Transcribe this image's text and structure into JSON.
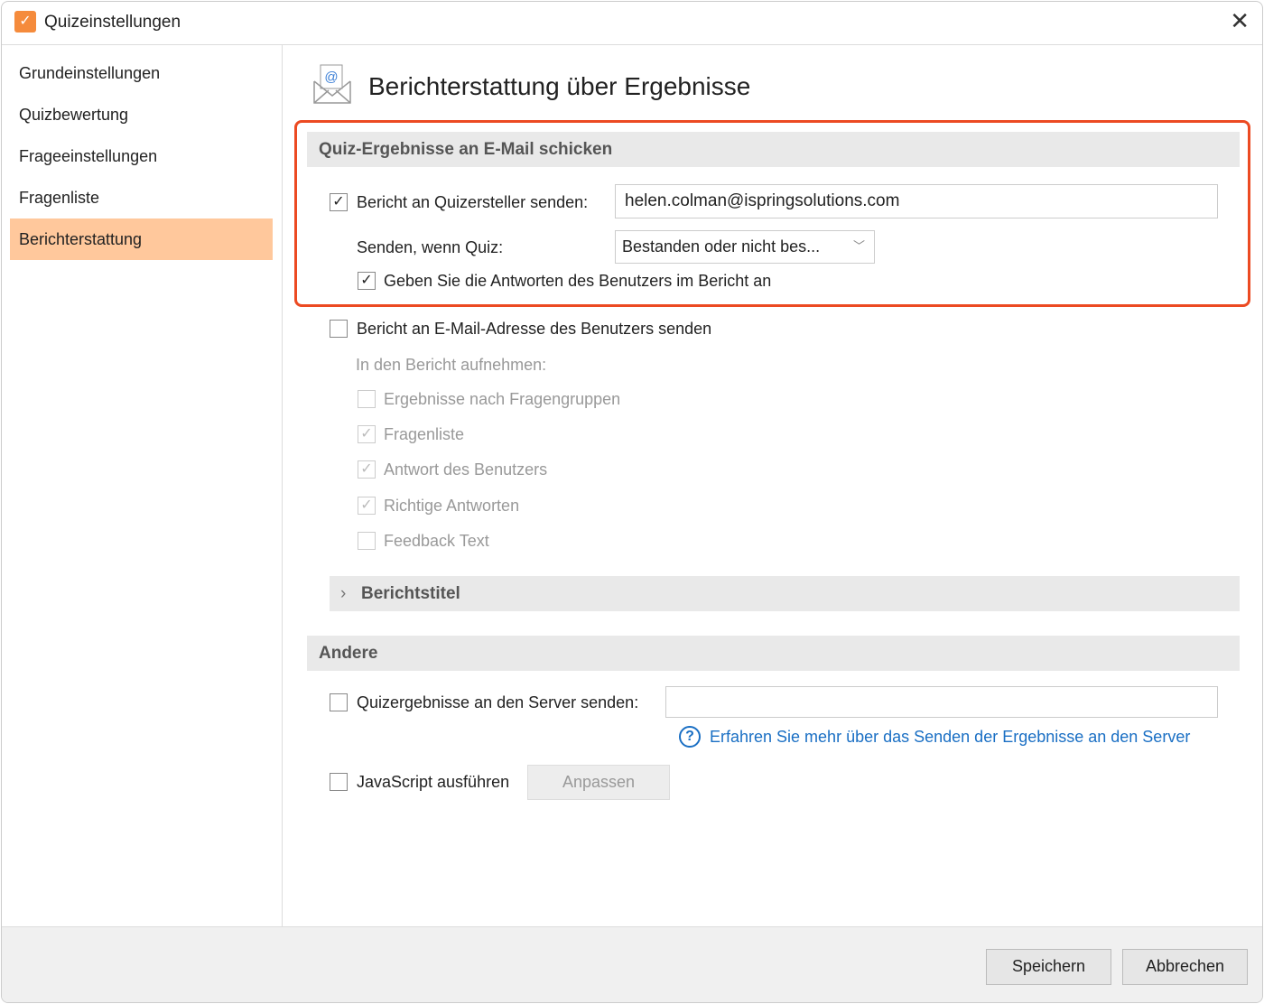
{
  "window": {
    "title": "Quizeinstellungen",
    "app_icon": "checkbox-icon",
    "close_icon": "close-icon"
  },
  "sidebar": {
    "items": [
      {
        "label": "Grundeinstellungen"
      },
      {
        "label": "Quizbewertung"
      },
      {
        "label": "Frageeinstellungen"
      },
      {
        "label": "Fragenliste"
      },
      {
        "label": "Berichterstattung",
        "active": true
      }
    ]
  },
  "main": {
    "title": "Berichterstattung über Ergebnisse",
    "email_section": {
      "header": "Quiz-Ergebnisse an E-Mail schicken",
      "send_to_author": {
        "label": "Bericht an Quizersteller senden:",
        "checked": true,
        "value": "helen.colman@ispringsolutions.com"
      },
      "send_when": {
        "label": "Senden, wenn Quiz:",
        "value": "Bestanden oder nicht bes..."
      },
      "include_answers": {
        "label": "Geben Sie die Antworten des Benutzers im Bericht an",
        "checked": true
      },
      "highlight_color": "#ec4a22"
    },
    "user_report": {
      "label": "Bericht an E-Mail-Adresse des Benutzers senden",
      "checked": false,
      "include_label": "In den Bericht aufnehmen:",
      "options": [
        {
          "label": "Ergebnisse nach Fragengruppen",
          "checked": false
        },
        {
          "label": "Fragenliste",
          "checked": true
        },
        {
          "label": "Antwort des Benutzers",
          "checked": true
        },
        {
          "label": "Richtige Antworten",
          "checked": true
        },
        {
          "label": "Feedback Text",
          "checked": false
        }
      ],
      "report_title": "Berichtstitel"
    },
    "other": {
      "header": "Andere",
      "server": {
        "label": "Quizergebnisse an den Server senden:",
        "checked": false,
        "value": ""
      },
      "help_link": "Erfahren Sie mehr über das Senden der Ergebnisse an den Server",
      "javascript": {
        "label": "JavaScript ausführen",
        "checked": false,
        "button": "Anpassen"
      }
    }
  },
  "footer": {
    "save": "Speichern",
    "cancel": "Abbrechen"
  }
}
